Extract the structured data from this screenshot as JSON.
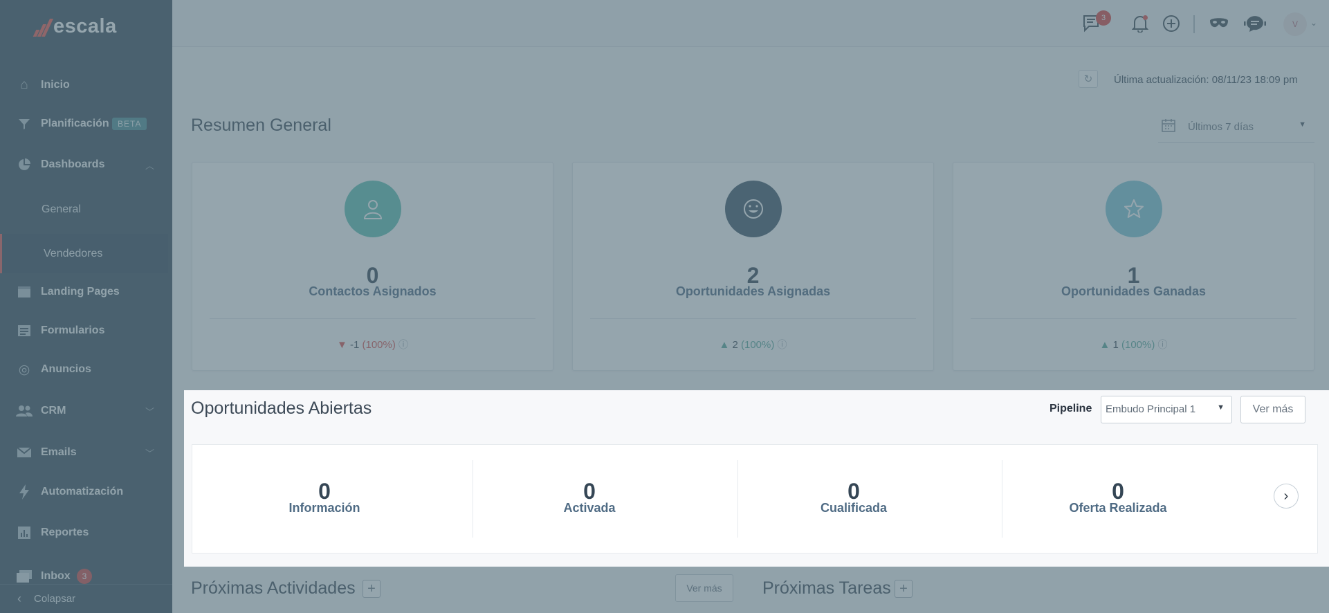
{
  "brand": {
    "name": "escala"
  },
  "sidebar": {
    "items": [
      {
        "label": "Inicio",
        "icon": "home-icon"
      },
      {
        "label": "Planificación",
        "icon": "filter-icon",
        "badge": "BETA"
      },
      {
        "label": "Dashboards",
        "icon": "pie-chart-icon",
        "expanded": true
      },
      {
        "label": "Landing Pages",
        "icon": "browser-window-icon"
      },
      {
        "label": "Formularios",
        "icon": "form-icon"
      },
      {
        "label": "Anuncios",
        "icon": "target-icon"
      },
      {
        "label": "CRM",
        "icon": "users-icon"
      },
      {
        "label": "Emails",
        "icon": "envelope-icon"
      },
      {
        "label": "Automatización",
        "icon": "lightning-icon"
      },
      {
        "label": "Reportes",
        "icon": "report-icon"
      },
      {
        "label": "Inbox",
        "icon": "inbox-icon",
        "count": "3"
      }
    ],
    "sub_items": [
      {
        "label": "General",
        "active": false
      },
      {
        "label": "Vendedores",
        "active": true
      }
    ],
    "collapse_label": "Colapsar"
  },
  "topbar": {
    "chat_count": "3",
    "avatar_initial": "V"
  },
  "header": {
    "last_update": "Última actualización: 08/11/23 18:09 pm"
  },
  "summary": {
    "title": "Resumen General",
    "date_range": "Últimos 7 días",
    "cards": [
      {
        "value": "0",
        "label": "Contactos Asignados",
        "delta": "-1",
        "pct": "(100%)",
        "trend": "down",
        "color": "#5dbfb2",
        "icon": "person-icon"
      },
      {
        "value": "2",
        "label": "Oportunidades Asignadas",
        "delta": "2",
        "pct": "(100%)",
        "trend": "up",
        "color": "#3d5566",
        "icon": "smiley-icon"
      },
      {
        "value": "1",
        "label": "Oportunidades Ganadas",
        "delta": "1",
        "pct": "(100%)",
        "trend": "up",
        "color": "#7cc6d6",
        "icon": "star-icon"
      }
    ]
  },
  "opportunities": {
    "title": "Oportunidades Abiertas",
    "pipeline_label": "Pipeline",
    "pipeline_value": "Embudo Principal 1",
    "ver_mas": "Ver más",
    "stages": [
      {
        "value": "0",
        "label": "Información"
      },
      {
        "value": "0",
        "label": "Activada"
      },
      {
        "value": "0",
        "label": "Cualificada"
      },
      {
        "value": "0",
        "label": "Oferta Realizada"
      }
    ]
  },
  "bottom": {
    "activities_title": "Próximas Actividades",
    "tasks_title": "Próximas Tareas",
    "ver_mas": "Ver más"
  }
}
